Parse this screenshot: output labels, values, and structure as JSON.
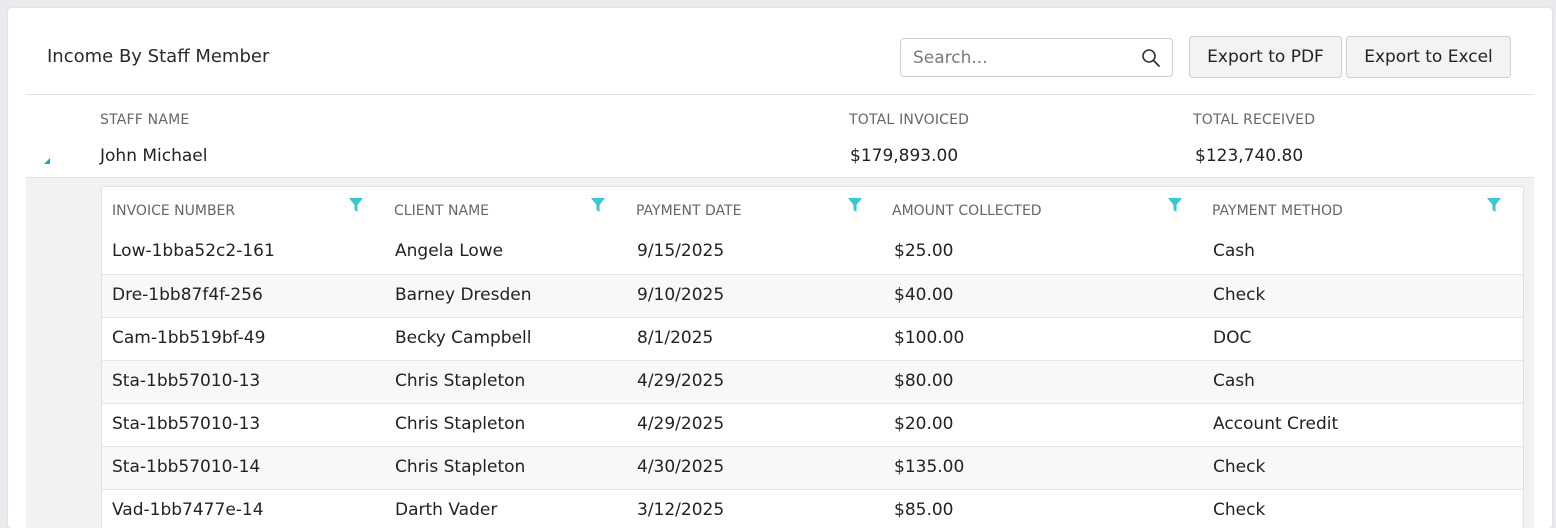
{
  "page": {
    "title": "Income By Staff Member"
  },
  "toolbar": {
    "search_placeholder": "Search...",
    "export_pdf_label": "Export to PDF",
    "export_excel_label": "Export to Excel"
  },
  "staff_table": {
    "columns": [
      "STAFF NAME",
      "TOTAL INVOICED",
      "TOTAL RECEIVED"
    ],
    "rows": [
      {
        "name": "John Michael",
        "total_invoiced": "$179,893.00",
        "total_received": "$123,740.80"
      }
    ]
  },
  "detail_table": {
    "columns": [
      "INVOICE NUMBER",
      "CLIENT NAME",
      "PAYMENT DATE",
      "AMOUNT COLLECTED",
      "PAYMENT METHOD"
    ],
    "rows": [
      [
        "Low-1bba52c2-161",
        "Angela Lowe",
        "9/15/2025",
        "$25.00",
        "Cash"
      ],
      [
        "Dre-1bb87f4f-256",
        "Barney Dresden",
        "9/10/2025",
        "$40.00",
        "Check"
      ],
      [
        "Cam-1bb519bf-49",
        "Becky Campbell",
        "8/1/2025",
        "$100.00",
        "DOC"
      ],
      [
        "Sta-1bb57010-13",
        "Chris Stapleton",
        "4/29/2025",
        "$80.00",
        "Cash"
      ],
      [
        "Sta-1bb57010-13",
        "Chris Stapleton",
        "4/29/2025",
        "$20.00",
        "Account Credit"
      ],
      [
        "Sta-1bb57010-14",
        "Chris Stapleton",
        "4/30/2025",
        "$135.00",
        "Check"
      ],
      [
        "Vad-1bb7477e-14",
        "Darth Vader",
        "3/12/2025",
        "$85.00",
        "Check"
      ]
    ]
  },
  "colors": {
    "accent_teal": "#3cc6cf",
    "toggle_teal": "#1aa6b3"
  },
  "icons": {
    "search": "search-icon",
    "filter": "filter-icon",
    "expand": "collapse-triangle-icon"
  }
}
